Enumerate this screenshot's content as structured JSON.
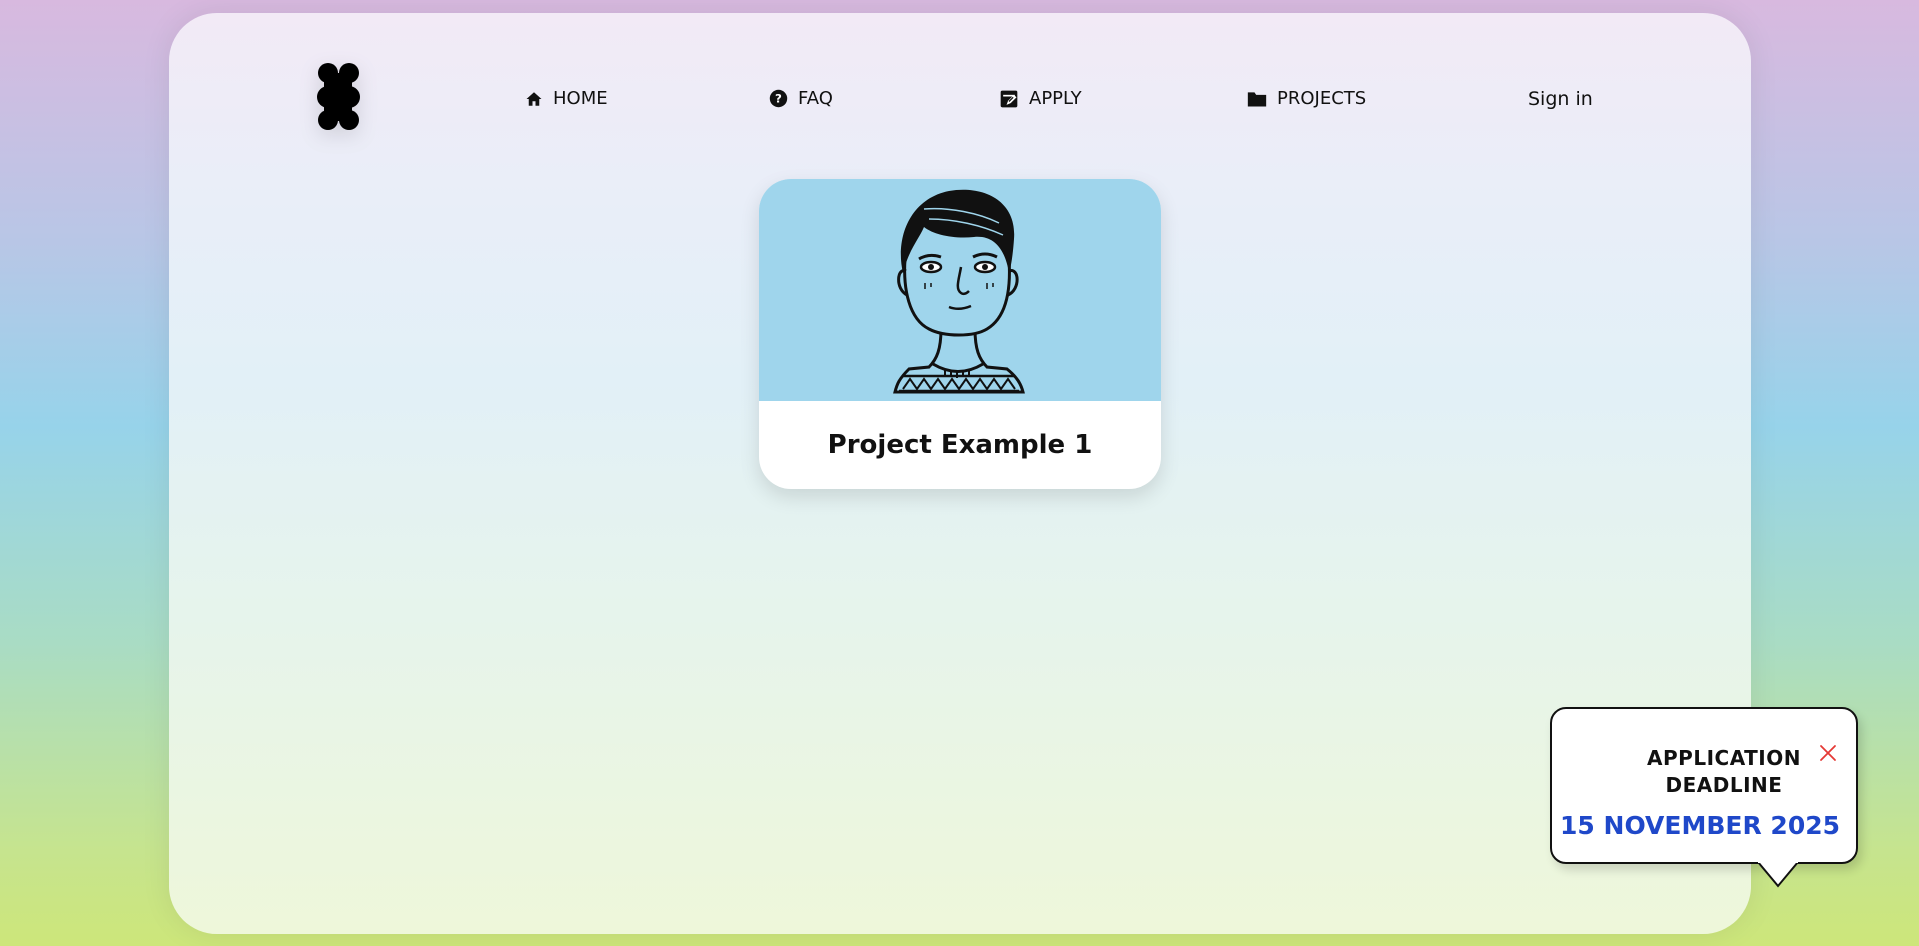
{
  "header": {
    "logo_icon": "logo-icon",
    "nav": [
      {
        "label": "HOME",
        "icon": "home-icon"
      },
      {
        "label": "FAQ",
        "icon": "question-circle-icon"
      },
      {
        "label": "APPLY",
        "icon": "note-edit-icon"
      },
      {
        "label": "PROJECTS",
        "icon": "folder-icon"
      }
    ],
    "signin_label": "Sign in"
  },
  "projects": [
    {
      "title": "Project Example 1",
      "image_icon": "avatar-illustration",
      "image_bg": "#9fd5ec"
    }
  ],
  "deadline_popup": {
    "label": "APPLICATION DEADLINE",
    "date": "15 NOVEMBER 2025",
    "date_color": "#1f48c9",
    "close_icon": "close-icon",
    "close_color": "#e53935"
  }
}
